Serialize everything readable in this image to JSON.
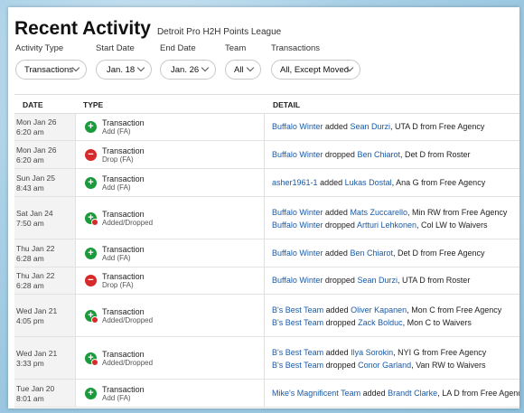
{
  "header": {
    "title": "Recent Activity",
    "league": "Detroit Pro H2H Points League"
  },
  "filters": {
    "activity_type": {
      "label": "Activity Type",
      "value": "Transactions"
    },
    "start_date": {
      "label": "Start Date",
      "value": "Jan. 18"
    },
    "end_date": {
      "label": "End Date",
      "value": "Jan. 26"
    },
    "team": {
      "label": "Team",
      "value": "All"
    },
    "transactions": {
      "label": "Transactions",
      "value": "All, Except Moved"
    }
  },
  "columns": {
    "date": "DATE",
    "type": "TYPE",
    "detail": "DETAIL"
  },
  "rows": [
    {
      "day": "Mon Jan 26",
      "time": "6:20 am",
      "type": "Transaction",
      "sub": "Add (FA)",
      "icon": "add",
      "lines": [
        {
          "team": "Buffalo Winter",
          "verb": "added",
          "player": "Sean Durzi",
          "rest": ", UTA D from Free Agency"
        }
      ]
    },
    {
      "day": "Mon Jan 26",
      "time": "6:20 am",
      "type": "Transaction",
      "sub": "Drop (FA)",
      "icon": "drop",
      "lines": [
        {
          "team": "Buffalo Winter",
          "verb": "dropped",
          "player": "Ben Chiarot",
          "rest": ", Det D from Roster"
        }
      ]
    },
    {
      "day": "Sun Jan 25",
      "time": "8:43 am",
      "type": "Transaction",
      "sub": "Add (FA)",
      "icon": "add",
      "lines": [
        {
          "team": "asher1961-1",
          "verb": "added",
          "player": "Lukas Dostal",
          "rest": ", Ana G from Free Agency"
        }
      ]
    },
    {
      "day": "Sat Jan 24",
      "time": "7:50 am",
      "type": "Transaction",
      "sub": "Added/Dropped",
      "icon": "both",
      "lines": [
        {
          "team": "Buffalo Winter",
          "verb": "added",
          "player": "Mats Zuccarello",
          "rest": ", Min RW from Free Agency"
        },
        {
          "team": "Buffalo Winter",
          "verb": "dropped",
          "player": "Artturi Lehkonen",
          "rest": ", Col LW to Waivers"
        }
      ]
    },
    {
      "day": "Thu Jan 22",
      "time": "6:28 am",
      "type": "Transaction",
      "sub": "Add (FA)",
      "icon": "add",
      "lines": [
        {
          "team": "Buffalo Winter",
          "verb": "added",
          "player": "Ben Chiarot",
          "rest": ", Det D from Free Agency"
        }
      ]
    },
    {
      "day": "Thu Jan 22",
      "time": "6:28 am",
      "type": "Transaction",
      "sub": "Drop (FA)",
      "icon": "drop",
      "lines": [
        {
          "team": "Buffalo Winter",
          "verb": "dropped",
          "player": "Sean Durzi",
          "rest": ", UTA D from Roster"
        }
      ]
    },
    {
      "day": "Wed Jan 21",
      "time": "4:05 pm",
      "type": "Transaction",
      "sub": "Added/Dropped",
      "icon": "both",
      "lines": [
        {
          "team": "B's Best Team",
          "verb": "added",
          "player": "Oliver Kapanen",
          "rest": ", Mon C from Free Agency"
        },
        {
          "team": "B's Best Team",
          "verb": "dropped",
          "player": "Zack Bolduc",
          "rest": ", Mon C to Waivers"
        }
      ]
    },
    {
      "day": "Wed Jan 21",
      "time": "3:33 pm",
      "type": "Transaction",
      "sub": "Added/Dropped",
      "icon": "both",
      "lines": [
        {
          "team": "B's Best Team",
          "verb": "added",
          "player": "Ilya Sorokin",
          "rest": ", NYI G from Free Agency"
        },
        {
          "team": "B's Best Team",
          "verb": "dropped",
          "player": "Conor Garland",
          "rest": ", Van RW to Waivers"
        }
      ]
    },
    {
      "day": "Tue Jan 20",
      "time": "8:01 am",
      "type": "Transaction",
      "sub": "Add (FA)",
      "icon": "add",
      "lines": [
        {
          "team": "Mike's Magnificent Team",
          "verb": "added",
          "player": "Brandt Clarke",
          "rest": ", LA D from Free Agency"
        }
      ]
    }
  ]
}
